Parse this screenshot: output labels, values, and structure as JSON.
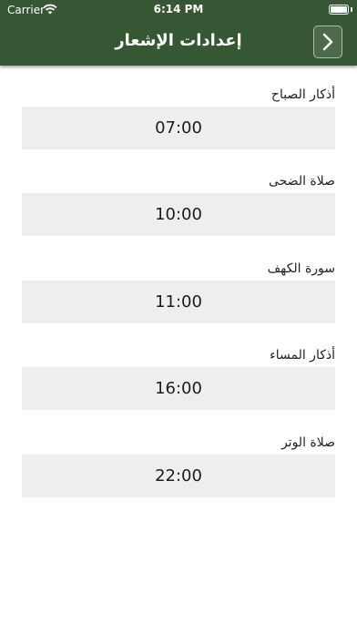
{
  "status_bar": {
    "carrier": "Carrier",
    "time": "6:14 PM"
  },
  "header": {
    "title": "إعدادات الإشعار",
    "back_icon": "chevron-right-icon"
  },
  "colors": {
    "header_bg": "#355734",
    "field_bg": "#eeeeee"
  },
  "reminders": [
    {
      "label": "أذكار الصباح",
      "time": "07:00"
    },
    {
      "label": "صلاة الضحى",
      "time": "10:00"
    },
    {
      "label": "سورة الكهف",
      "time": "11:00"
    },
    {
      "label": "أذكار المساء",
      "time": "16:00"
    },
    {
      "label": "صلاة الوتر",
      "time": "22:00"
    }
  ]
}
